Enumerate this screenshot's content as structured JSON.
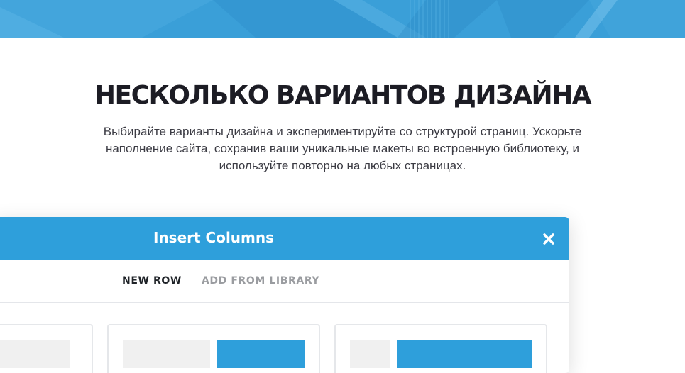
{
  "banner": {
    "background_color": "#3a9fd8"
  },
  "section": {
    "heading": "НЕСКОЛЬКО ВАРИАНТОВ ДИЗАЙНА",
    "description_line1": "Выбирайте варианты дизайна и экспериментируйте со структурой страниц. Ускорьте",
    "description_line2": "наполнение сайта, сохранив ваши уникальные макеты во встроенную библиотеку, и",
    "description_line3": "используйте повторно на любых страницах."
  },
  "modal": {
    "title": "Insert Columns",
    "close_icon": "close-icon",
    "header_color": "#2e9fdb",
    "tabs": [
      {
        "label": "NEW ROW",
        "active": true
      },
      {
        "label": "ADD FROM LIBRARY",
        "active": false
      }
    ],
    "layout_options_visible": 3
  }
}
